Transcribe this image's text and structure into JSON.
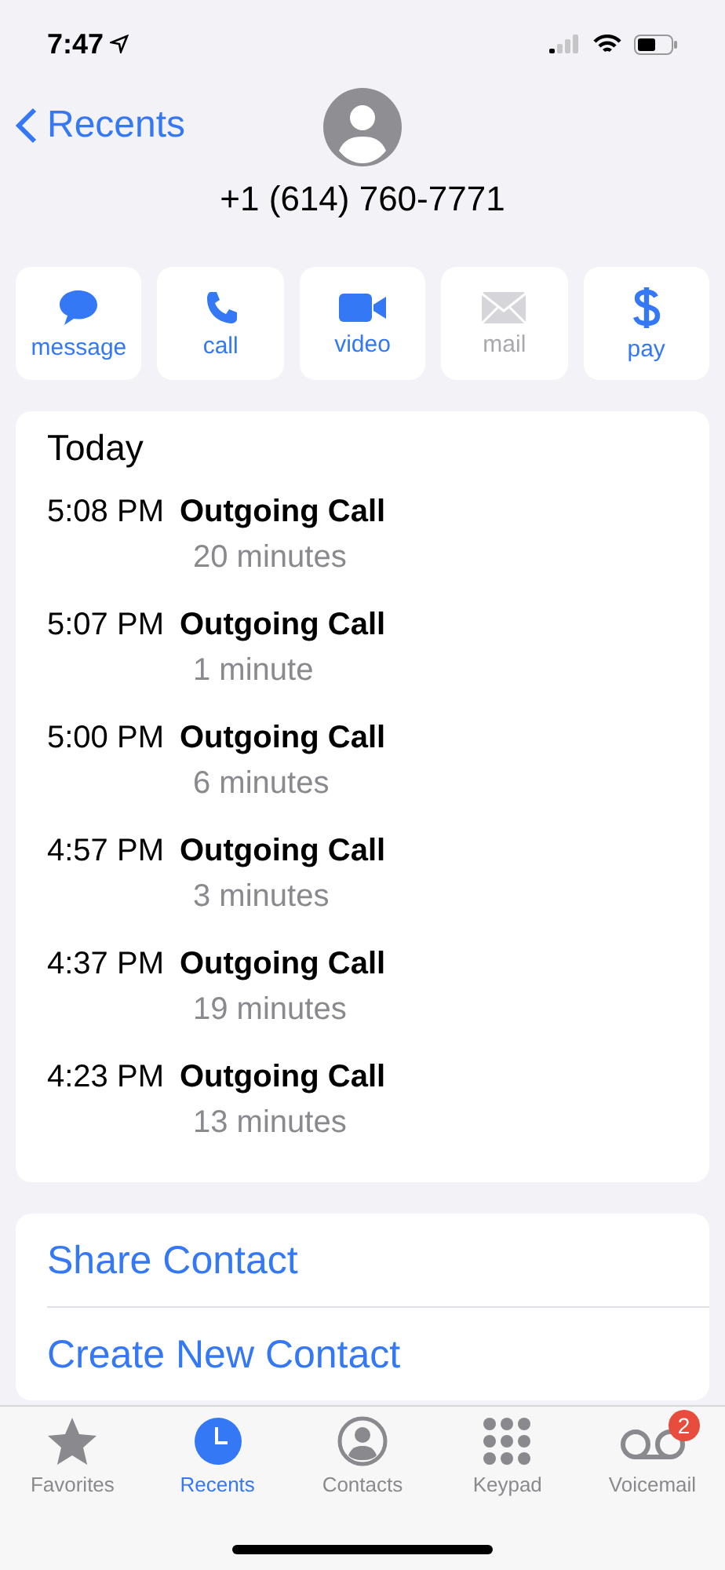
{
  "status_bar": {
    "time": "7:47"
  },
  "header": {
    "back": "Recents",
    "phone": "+1 (614) 760-7771"
  },
  "actions": [
    {
      "kind": "message",
      "label": "message",
      "disabled": false
    },
    {
      "kind": "call",
      "label": "call",
      "disabled": false
    },
    {
      "kind": "video",
      "label": "video",
      "disabled": false
    },
    {
      "kind": "mail",
      "label": "mail",
      "disabled": true
    },
    {
      "kind": "pay",
      "label": "pay",
      "disabled": false
    }
  ],
  "history": {
    "title": "Today",
    "calls": [
      {
        "time": "5:08 PM",
        "type": "Outgoing Call",
        "duration": "20 minutes"
      },
      {
        "time": "5:07 PM",
        "type": "Outgoing Call",
        "duration": "1 minute"
      },
      {
        "time": "5:00 PM",
        "type": "Outgoing Call",
        "duration": "6 minutes"
      },
      {
        "time": "4:57 PM",
        "type": "Outgoing Call",
        "duration": "3 minutes"
      },
      {
        "time": "4:37 PM",
        "type": "Outgoing Call",
        "duration": "19 minutes"
      },
      {
        "time": "4:23 PM",
        "type": "Outgoing Call",
        "duration": "13 minutes"
      }
    ]
  },
  "links": [
    "Share Contact",
    "Create New Contact"
  ],
  "tab_bar": [
    {
      "kind": "favorites",
      "label": "Favorites",
      "selected": false
    },
    {
      "kind": "recents",
      "label": "Recents",
      "selected": true
    },
    {
      "kind": "contacts",
      "label": "Contacts",
      "selected": false
    },
    {
      "kind": "keypad",
      "label": "Keypad",
      "selected": false
    },
    {
      "kind": "voicemail",
      "label": "Voicemail",
      "selected": false,
      "badge": "2"
    }
  ]
}
